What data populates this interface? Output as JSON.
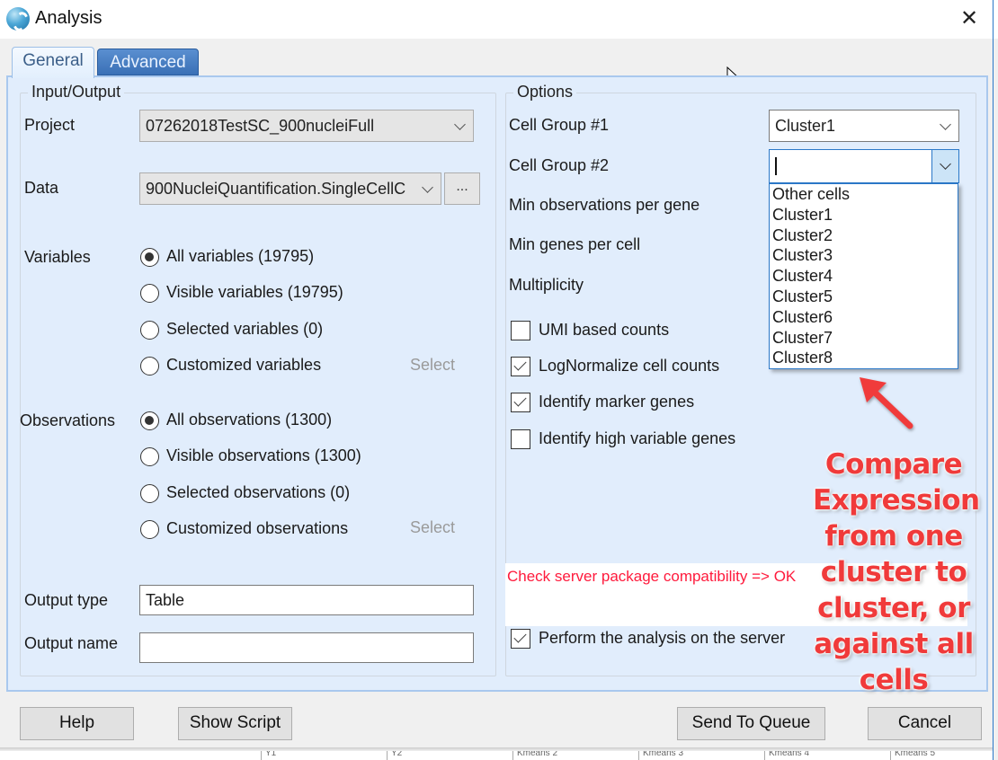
{
  "window": {
    "title": "Analysis",
    "app_icon": "app-logo-icon",
    "close_icon": "close-icon",
    "close_glyph": "✕"
  },
  "tabs": [
    {
      "label": "General",
      "active": true
    },
    {
      "label": "Advanced",
      "active": false
    }
  ],
  "input_output": {
    "legend": "Input/Output",
    "project_label": "Project",
    "project_value": "07262018TestSC_900nucleiFull",
    "data_label": "Data",
    "data_value": "900NucleiQuantification.SingleCellC",
    "data_browse_label": "...",
    "variables_label": "Variables",
    "variables_options": [
      {
        "label": "All variables (19795)",
        "selected": true
      },
      {
        "label": "Visible variables (19795)",
        "selected": false
      },
      {
        "label": "Selected variables (0)",
        "selected": false
      },
      {
        "label": "Customized variables",
        "selected": false
      }
    ],
    "variables_select_link": "Select",
    "observations_label": "Observations",
    "observations_options": [
      {
        "label": "All observations (1300)",
        "selected": true
      },
      {
        "label": "Visible observations (1300)",
        "selected": false
      },
      {
        "label": "Selected observations (0)",
        "selected": false
      },
      {
        "label": "Customized observations",
        "selected": false
      }
    ],
    "observations_select_link": "Select",
    "output_type_label": "Output type",
    "output_type_value": "Table",
    "output_name_label": "Output name",
    "output_name_value": ""
  },
  "options": {
    "legend": "Options",
    "cell_group1_label": "Cell Group #1",
    "cell_group1_value": "Cluster1",
    "cell_group2_label": "Cell Group #2",
    "cell_group2_value": "",
    "cell_group2_dropdown_open": true,
    "cell_group2_options": [
      "Other cells",
      "Cluster1",
      "Cluster2",
      "Cluster3",
      "Cluster4",
      "Cluster5",
      "Cluster6",
      "Cluster7",
      "Cluster8"
    ],
    "min_obs_per_gene_label": "Min observations per gene",
    "min_genes_per_cell_label": "Min genes per cell",
    "multiplicity_label": "Multiplicity",
    "checkboxes": [
      {
        "label": "UMI based counts",
        "checked": false
      },
      {
        "label": "LogNormalize cell counts",
        "checked": true
      },
      {
        "label": "Identify marker genes",
        "checked": true
      },
      {
        "label": "Identify high variable genes",
        "checked": false
      }
    ],
    "status_message": "Check server package compatibility => OK",
    "status_color": "#ff1a3c",
    "server_checkbox": {
      "label": "Perform the analysis on the server",
      "checked": true
    }
  },
  "annotation": {
    "text": "Compare Expression from one cluster to cluster, or against all cells",
    "color": "#f03a3a"
  },
  "footer": {
    "help": "Help",
    "show_script": "Show Script",
    "send_to_queue": "Send To Queue",
    "cancel": "Cancel"
  },
  "background_table_headers": [
    "Y1",
    "Y2",
    "Kmeans 2",
    "Kmeans 3",
    "Kmeans 4",
    "Kmeans 5"
  ],
  "colors": {
    "accent": "#2b78c8",
    "panel_bg": "#e1edfc",
    "tab_advanced_bg": "#3a70b6"
  }
}
